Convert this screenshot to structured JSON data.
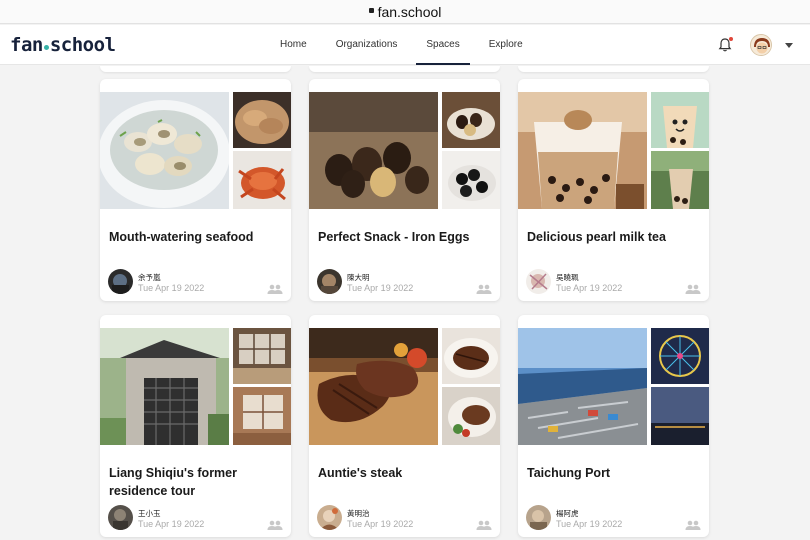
{
  "browser": {
    "url": "fan.school"
  },
  "header": {
    "logo": {
      "left": "fan",
      "right": "school"
    },
    "nav": [
      {
        "label": "Home",
        "active": false
      },
      {
        "label": "Organizations",
        "active": false
      },
      {
        "label": "Spaces",
        "active": true
      },
      {
        "label": "Explore",
        "active": false
      }
    ]
  },
  "cards": [
    {
      "title": "Mouth-watering seafood",
      "author": "余予嵐",
      "date": "Tue Apr 19 2022"
    },
    {
      "title": "Perfect Snack - Iron Eggs",
      "author": "陳大明",
      "date": "Tue Apr 19 2022"
    },
    {
      "title": "Delicious pearl milk tea",
      "author": "吳曉珮",
      "date": "Tue Apr 19 2022"
    },
    {
      "title": "Liang Shiqiu's former residence tour",
      "author": "王小玉",
      "date": "Tue Apr 19 2022"
    },
    {
      "title": "Auntie's steak",
      "author": "黃明治",
      "date": "Tue Apr 19 2022"
    },
    {
      "title": "Taichung Port",
      "author": "楊阿虎",
      "date": "Tue Apr 19 2022"
    }
  ],
  "colors": {
    "accent": "#36b3a8",
    "brand": "#17223b",
    "notification": "#e0473a"
  }
}
